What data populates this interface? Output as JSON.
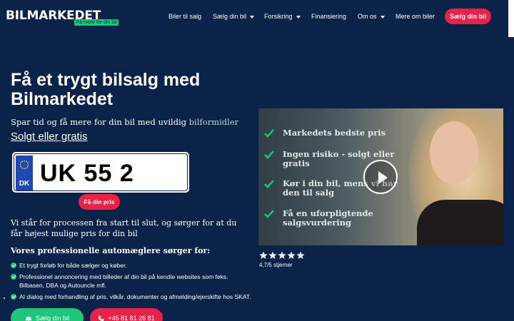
{
  "header": {
    "logo": "BILMARKEDET",
    "logo_tagline": "Få mere for din bil",
    "nav": [
      {
        "label": "Biler til salg",
        "dropdown": false
      },
      {
        "label": "Sælg din bil",
        "dropdown": true
      },
      {
        "label": "Forsikring",
        "dropdown": true
      },
      {
        "label": "Finansiering",
        "dropdown": false
      },
      {
        "label": "Om os",
        "dropdown": true
      },
      {
        "label": "Mere om biler",
        "dropdown": false
      }
    ],
    "cta_label": "Sælg din bil"
  },
  "hero": {
    "title": "Få et trygt bilsalg med Bilmarkedet",
    "subtitle_main": "Spar tid og få mere for din bil med uvildig ",
    "subtitle_highlight": "bilformidler",
    "link": "Solgt eller gratis",
    "plate": {
      "country": "DK",
      "number": "UK 55 2"
    },
    "find_button": "Få din pris",
    "paragraph": "Vi står for processen fra start til slut, og sørger for at du får højest mulige pris for din bil",
    "list_heading": "Vores professionelle automæglere sørger for:",
    "bullets": [
      "Et trygt forløb for både sælger og køber.",
      "Professionel annoncering med billeder af din bil på kendte websites som feks. Bilbasen, DBA og Autouncle mfl.",
      "AI dialog med forhandling af pris, vilkår, dokumenter og afmelding/ejerskifte hos SKAT."
    ],
    "btn_sell": "Sælg din bil",
    "btn_phone": "+45 81 81 26 81"
  },
  "video": {
    "items": [
      "Markedets bedste pris",
      "Ingen risiko - solgt eller gratis",
      "Kør i din bil, mens vi har den til salg",
      "Få en uforpligtende salgsvurdering"
    ]
  },
  "rating": {
    "stars": 5,
    "text": "4,7/5 stjerner"
  },
  "colors": {
    "background": "#0b2348",
    "accent_red": "#e8234a",
    "accent_green": "#21c47b"
  }
}
